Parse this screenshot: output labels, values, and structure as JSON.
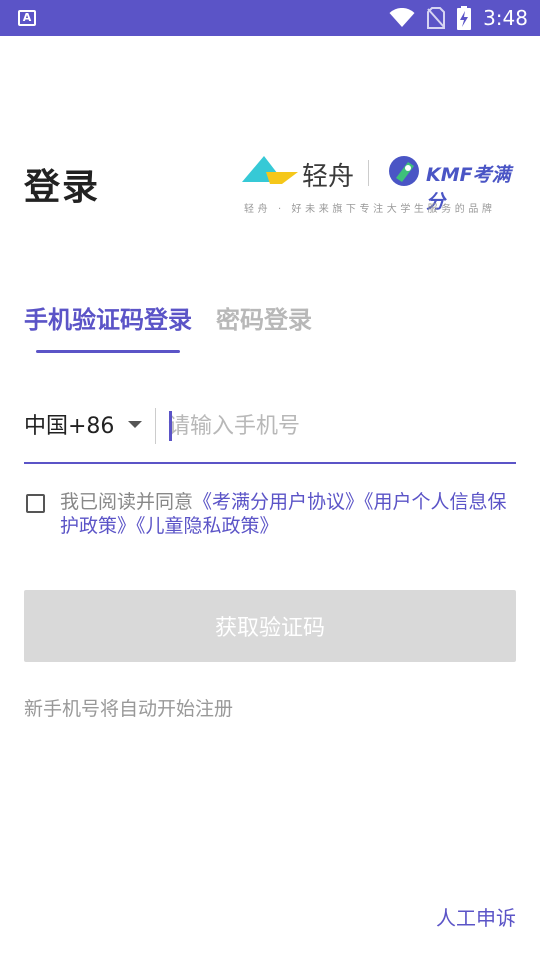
{
  "status_bar": {
    "left_icon_letter": "A",
    "time": "3:48",
    "icons": [
      "wifi-icon",
      "no-sim-icon",
      "battery-charging-icon"
    ]
  },
  "header": {
    "title": "登录",
    "brand": {
      "qingzhou_name": "轻舟",
      "kmf_name": "KMF考满分",
      "slogan": "轻舟 · 好未来旗下专注大学生服务的品牌"
    }
  },
  "tabs": [
    {
      "label": "手机验证码登录",
      "active": true
    },
    {
      "label": "密码登录",
      "active": false
    }
  ],
  "phone_form": {
    "country_code": "中国+86",
    "phone_placeholder": "请输入手机号",
    "phone_value": ""
  },
  "agreement": {
    "prefix": "我已阅读并同意",
    "link_user_agreement": "《考满分用户协议》",
    "link_privacy_policy": "《用户个人信息保护政策》",
    "link_child_privacy": "《儿童隐私政策》",
    "checked": false
  },
  "actions": {
    "get_code_label": "获取验证码",
    "new_number_hint": "新手机号将自动开始注册",
    "complaint_label": "人工申诉"
  },
  "colors": {
    "accent": "#5b54c7",
    "disabled_button": "#d9d9d9"
  }
}
